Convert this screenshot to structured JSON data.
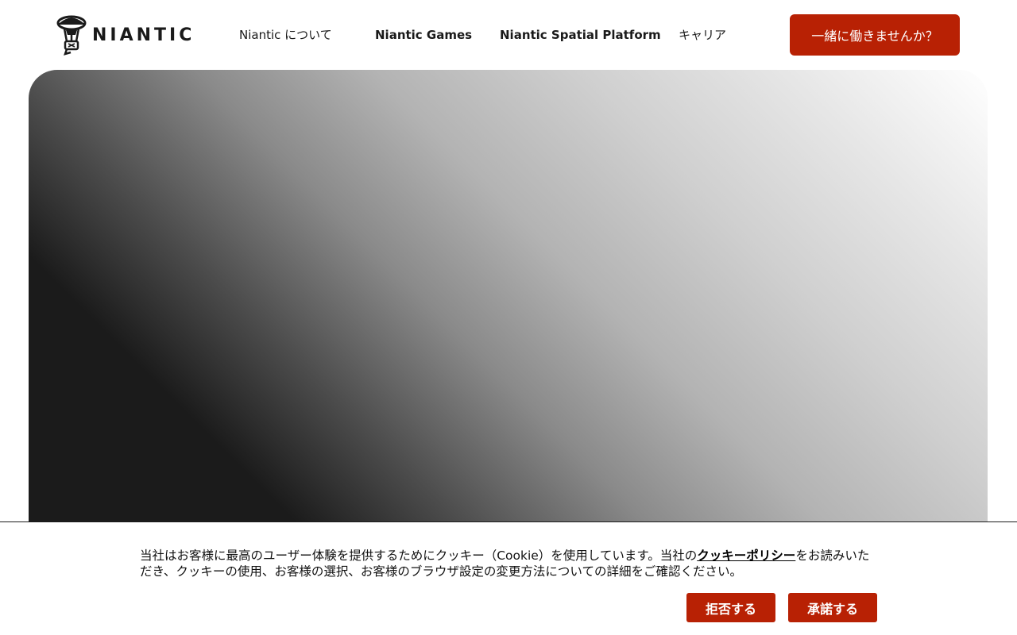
{
  "header": {
    "logo": {
      "text": "NIANTIC",
      "icon": "niantic-balloon-logo-icon"
    },
    "nav": [
      {
        "label": "Niantic について"
      },
      {
        "label": "Niantic Games"
      },
      {
        "label": "Niantic Spatial Platform"
      },
      {
        "label": "キャリア"
      }
    ],
    "cta_label": "一緒に働きませんか？"
  },
  "hero": {
    "gradient": [
      "#1b1b1b",
      "#ffffff"
    ]
  },
  "cookie_banner": {
    "text_before": "当社はお客様に最高のユーザー体験を提供するためにクッキー（Cookie）を使用しています。当社の",
    "policy_link": "クッキーポリシー",
    "text_after": "をお読みいただき、クッキーの使用、お客様の選択、お客様のブラウザ設定の変更方法についての詳細をご確認ください。",
    "reject_label": "拒否する",
    "accept_label": "承諾する"
  },
  "colors": {
    "accent": "#b82104",
    "text": "#1a1a1a",
    "background": "#ffffff"
  }
}
